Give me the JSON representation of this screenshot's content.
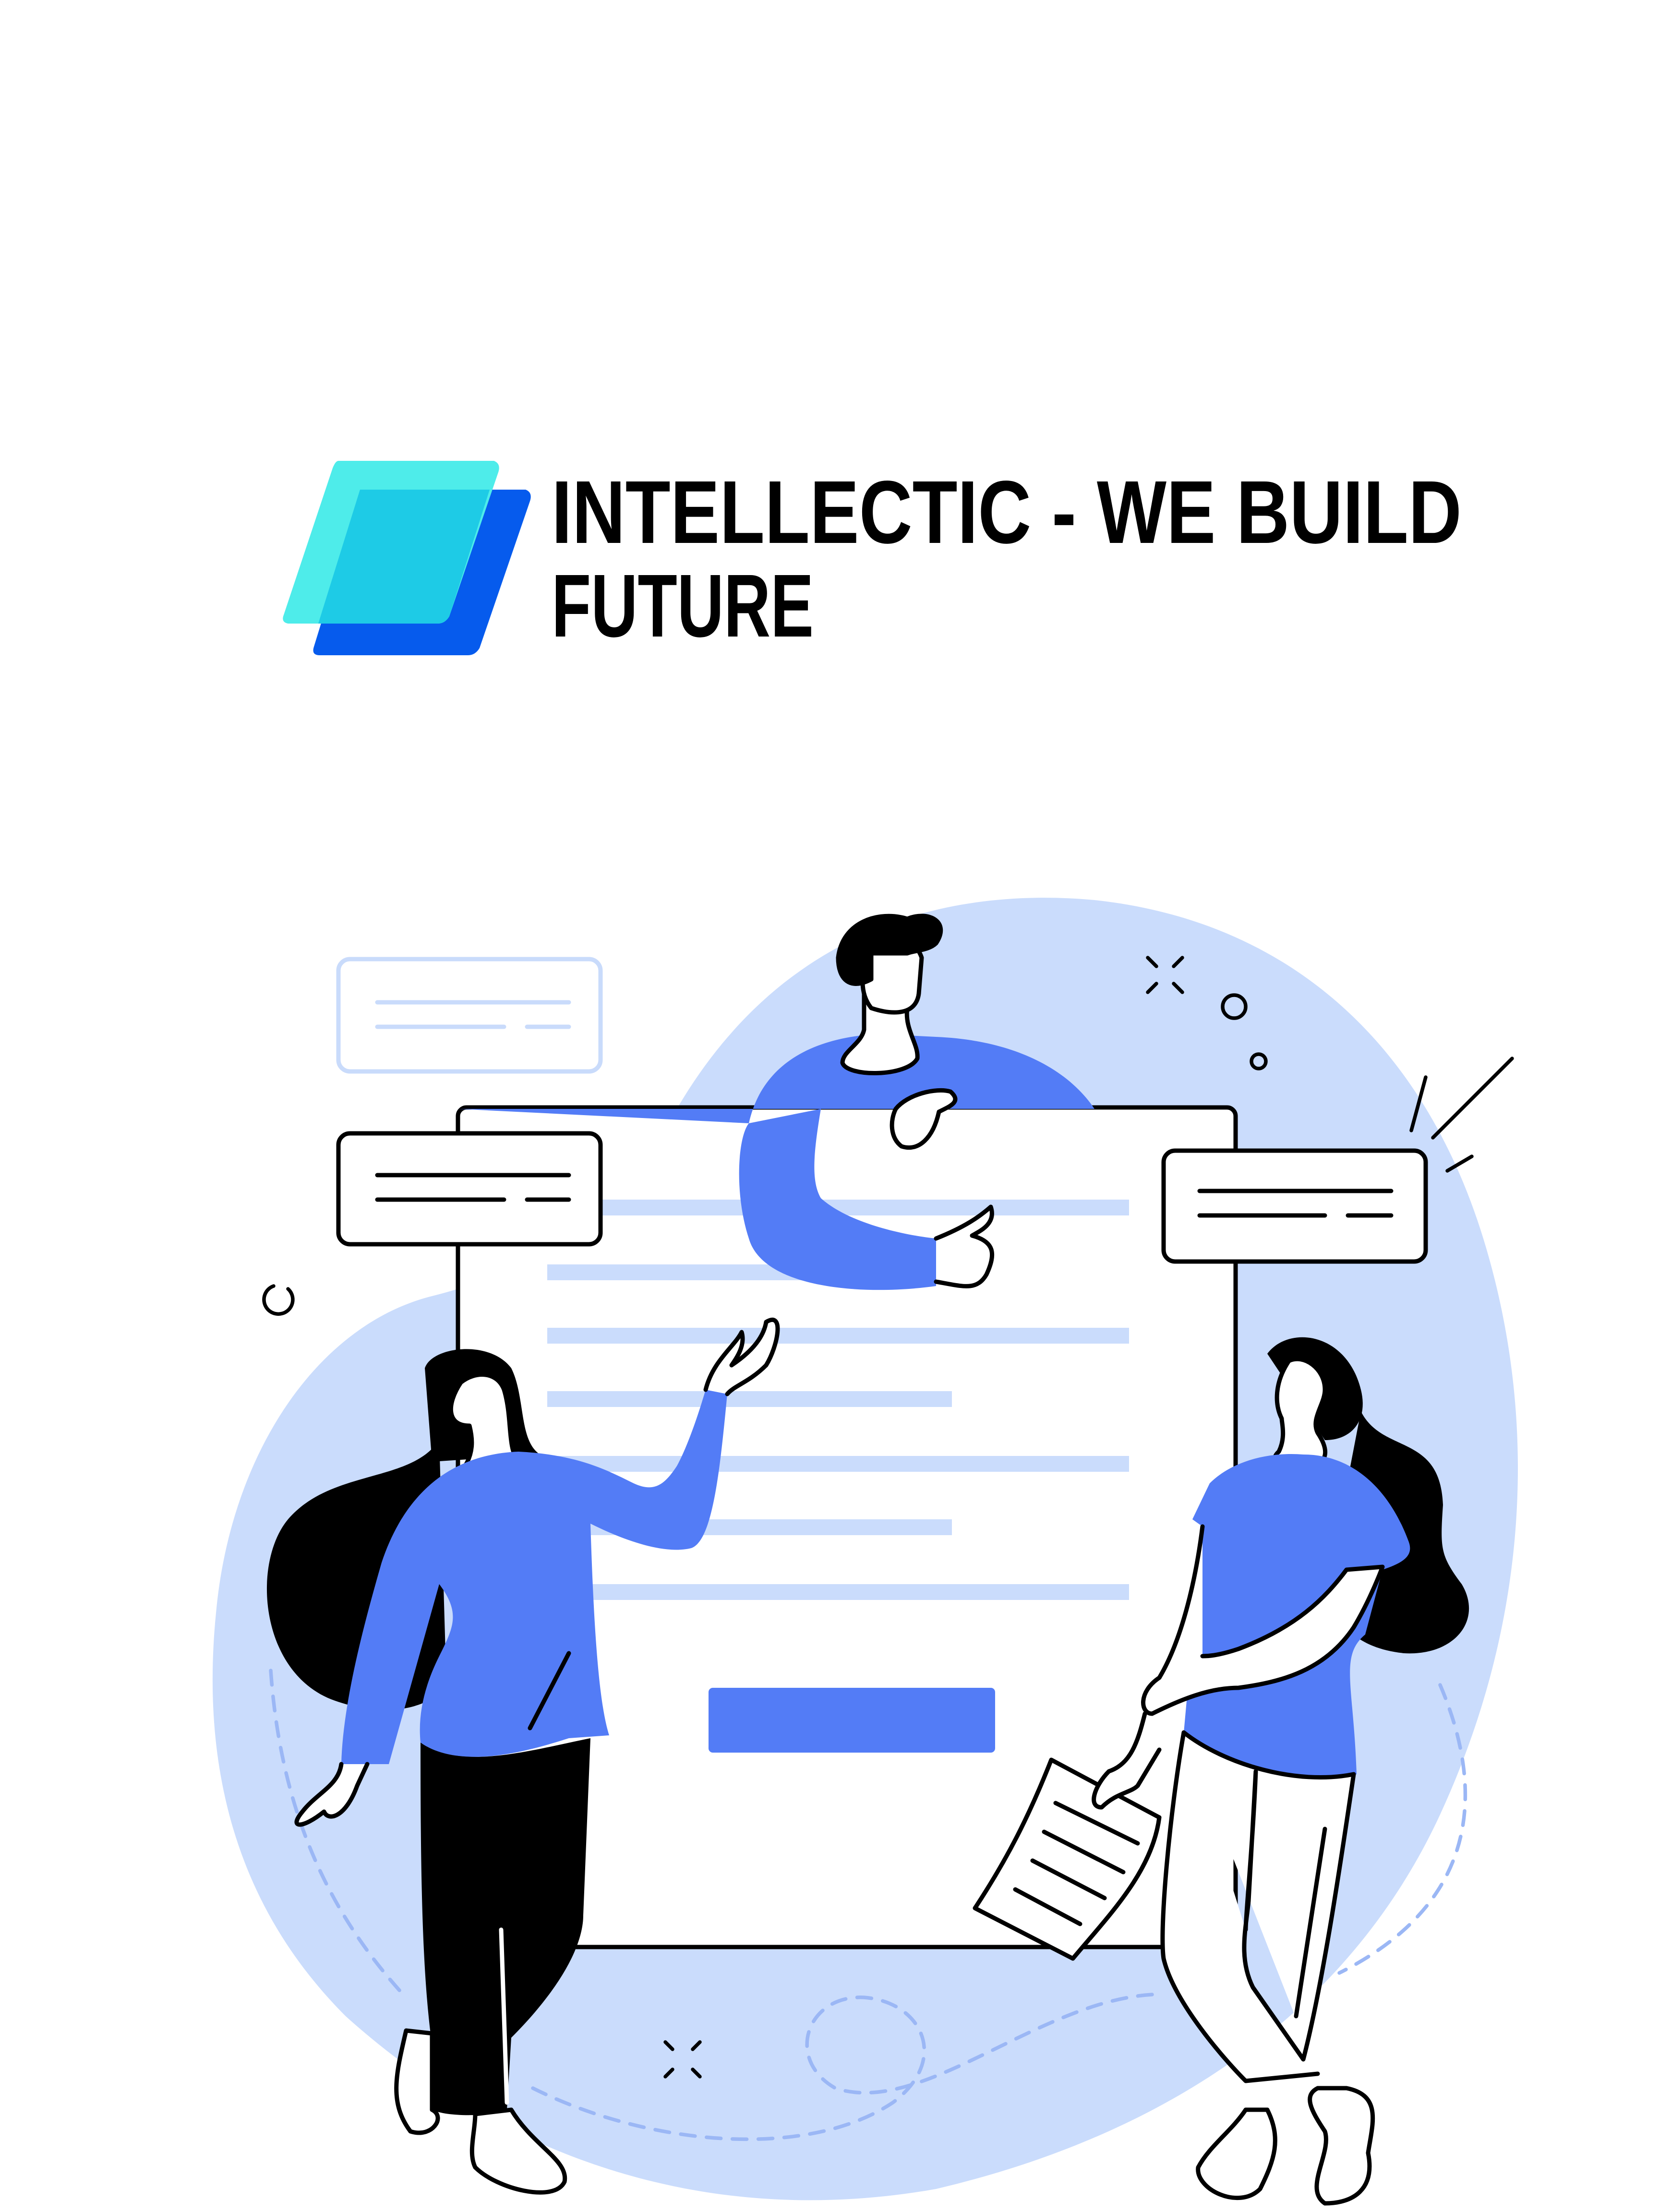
{
  "logo": {
    "line1": "INTELLECTIC - WE BUILD",
    "line2": "FUTURE",
    "icon": "parallelogram-layers-icon"
  },
  "colors": {
    "logo_cyan": "#4EECEA",
    "logo_overlap": "#1ECBE6",
    "logo_blue": "#065BED",
    "accent_blue": "#537CF6",
    "blob_light": "#CADCFC",
    "line_light": "#C9DBFB",
    "ink": "#000000"
  },
  "illustration": {
    "subject": "team collaborating around a form"
  }
}
